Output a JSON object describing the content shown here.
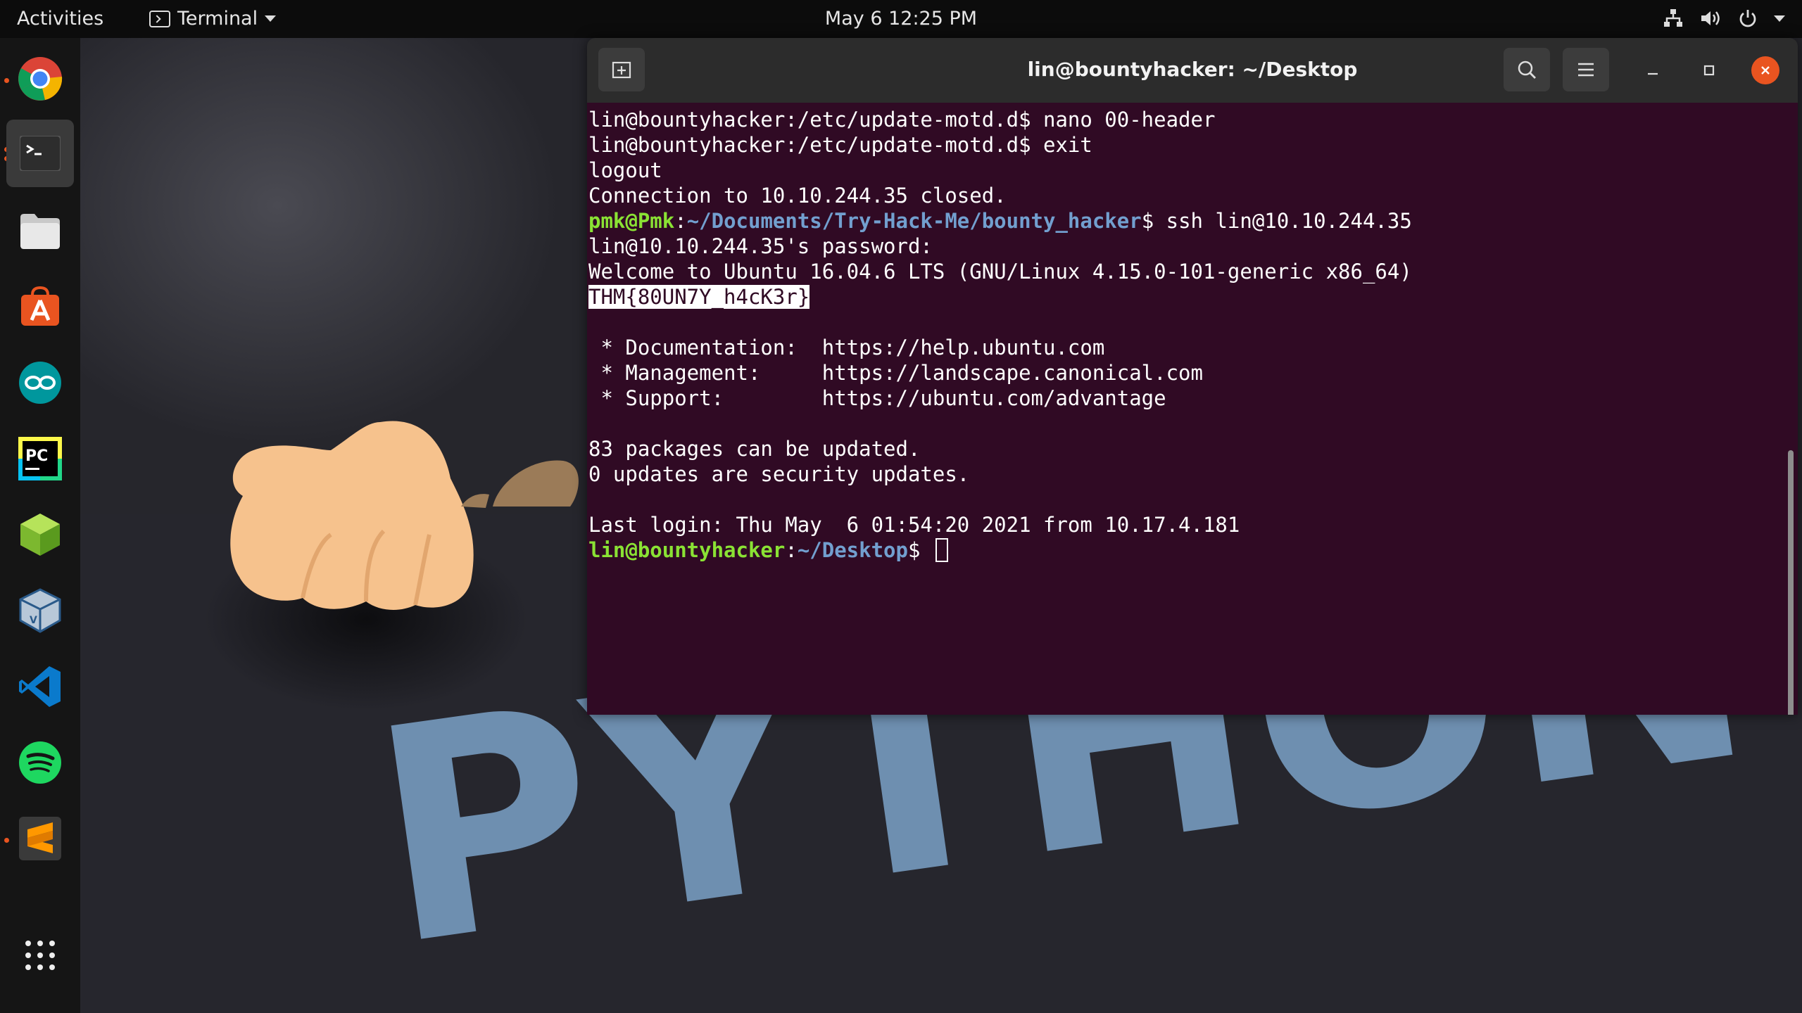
{
  "topbar": {
    "activities": "Activities",
    "app_name": "Terminal",
    "clock": "May 6  12:25 PM",
    "tray_icons": [
      "network-icon",
      "volume-icon",
      "power-icon"
    ]
  },
  "dock": {
    "items": [
      {
        "name": "chrome",
        "label": "Google Chrome",
        "running": true
      },
      {
        "name": "terminal",
        "label": "Terminal",
        "running": true,
        "active": true
      },
      {
        "name": "files",
        "label": "Files"
      },
      {
        "name": "ubuntu-software",
        "label": "Ubuntu Software"
      },
      {
        "name": "arduino",
        "label": "Arduino IDE"
      },
      {
        "name": "pycharm",
        "label": "PyCharm"
      },
      {
        "name": "cube-app",
        "label": "Application"
      },
      {
        "name": "virtualbox",
        "label": "VirtualBox"
      },
      {
        "name": "vscode",
        "label": "Visual Studio Code"
      },
      {
        "name": "spotify",
        "label": "Spotify"
      },
      {
        "name": "sublime-text",
        "label": "Sublime Text",
        "running": true
      }
    ],
    "show_apps_icon": "grid-icon"
  },
  "terminal": {
    "title": "lin@bountyhacker: ~/Desktop",
    "lines": {
      "l1": "lin@bountyhacker:/etc/update-motd.d$ nano 00-header",
      "l2": "lin@bountyhacker:/etc/update-motd.d$ exit",
      "l3": "logout",
      "l4": "Connection to 10.10.244.35 closed.",
      "l5_user": "pmk@Pmk",
      "l5_sep": ":",
      "l5_path": "~/Documents/Try-Hack-Me/bounty_hacker",
      "l5_cmd": "$ ssh lin@10.10.244.35",
      "l6": "lin@10.10.244.35's password:",
      "l7": "Welcome to Ubuntu 16.04.6 LTS (GNU/Linux 4.15.0-101-generic x86_64)",
      "l8_flag": "THM{80UN7Y_h4cK3r}",
      "l10": " * Documentation:  https://help.ubuntu.com",
      "l11": " * Management:     https://landscape.canonical.com",
      "l12": " * Support:        https://ubuntu.com/advantage",
      "l14": "83 packages can be updated.",
      "l15": "0 updates are security updates.",
      "l17": "Last login: Thu May  6 01:54:20 2021 from 10.17.4.181",
      "l18_user": "lin@bountyhacker",
      "l18_sep": ":",
      "l18_path": "~/Desktop",
      "l18_prompt": "$ "
    }
  },
  "wallpaper": {
    "text": "PYTHON",
    "text_color": "#6e8fb0"
  },
  "colors": {
    "terminal_bg": "#300a24",
    "prompt_green": "#8ae234",
    "path_blue": "#729fcf",
    "close_button": "#e95420"
  }
}
